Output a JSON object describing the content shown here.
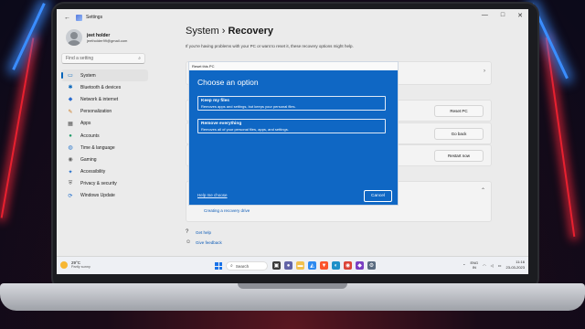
{
  "window": {
    "title": "Settings",
    "controls": [
      "—",
      "□",
      "✕"
    ]
  },
  "profile": {
    "name": "jeet holder",
    "email": "jeetholder99@gmail.com"
  },
  "search": {
    "placeholder": "Find a setting"
  },
  "nav": [
    {
      "label": "System",
      "icon": "monitor-icon",
      "glyph": "▭",
      "color": "#0067c0",
      "active": true
    },
    {
      "label": "Bluetooth & devices",
      "icon": "bluetooth-icon",
      "glyph": "✱",
      "color": "#0067c0"
    },
    {
      "label": "Network & internet",
      "icon": "wifi-icon",
      "glyph": "◆",
      "color": "#2b6fd6"
    },
    {
      "label": "Personalization",
      "icon": "brush-icon",
      "glyph": "✎",
      "color": "#d07a1a"
    },
    {
      "label": "Apps",
      "icon": "apps-icon",
      "glyph": "▦",
      "color": "#555555"
    },
    {
      "label": "Accounts",
      "icon": "person-icon",
      "glyph": "●",
      "color": "#22a06b"
    },
    {
      "label": "Time & language",
      "icon": "globe-icon",
      "glyph": "◍",
      "color": "#2a7bd3"
    },
    {
      "label": "Gaming",
      "icon": "gamepad-icon",
      "glyph": "◉",
      "color": "#666666"
    },
    {
      "label": "Accessibility",
      "icon": "accessibility-icon",
      "glyph": "✦",
      "color": "#1f6fd1"
    },
    {
      "label": "Privacy & security",
      "icon": "shield-icon",
      "glyph": "⛨",
      "color": "#666666"
    },
    {
      "label": "Windows Update",
      "icon": "update-icon",
      "glyph": "⟳",
      "color": "#1f6fd1"
    }
  ],
  "header": {
    "section": "System",
    "sep": "›",
    "page": "Recovery",
    "subtitle": "If you're having problems with your PC or want to reset it, these recovery options might help."
  },
  "cards": {
    "reset_button": "Reset PC",
    "goback_button": "Go back",
    "restart_button": "Restart now",
    "recovery_drive_link": "Creating a recovery drive",
    "chevron_right": "›",
    "chevron_up": "⌃"
  },
  "help": {
    "get_help": "Get help",
    "feedback": "Give feedback"
  },
  "dialog": {
    "window_title": "Reset this PC",
    "heading": "Choose an option",
    "options": [
      {
        "title": "Keep my files",
        "desc": "Removes apps and settings, but keeps your personal files."
      },
      {
        "title": "Remove everything",
        "desc": "Removes all of your personal files, apps, and settings."
      }
    ],
    "help_link": "Help me choose",
    "cancel": "Cancel",
    "accent": "#0f67c4"
  },
  "taskbar": {
    "weather_temp": "29°C",
    "weather_cond": "Partly sunny",
    "search_label": "Search",
    "lang_1": "ENG",
    "lang_2": "IN",
    "time": "11:16",
    "date": "23-03-2023"
  }
}
